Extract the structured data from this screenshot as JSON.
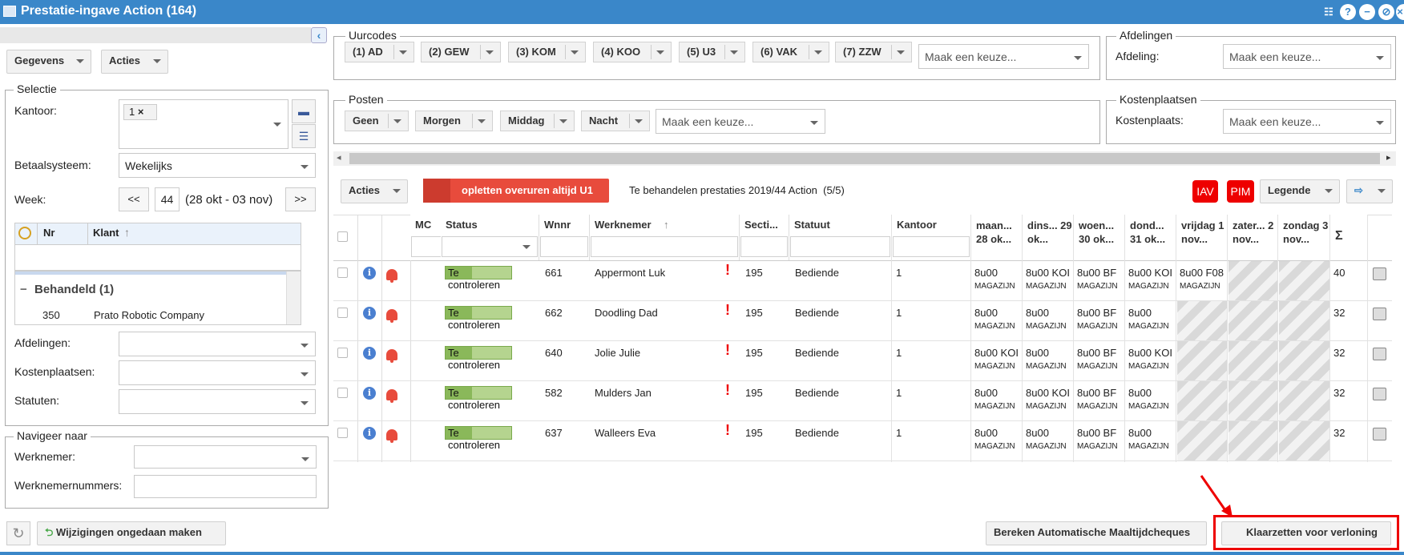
{
  "window": {
    "title": "Prestatie-ingave Action (164)"
  },
  "left": {
    "gegevens": "Gegevens",
    "acties": "Acties",
    "selectie": "Selectie",
    "kantoor_label": "Kantoor:",
    "kantoor_chip": "1",
    "betaal_label": "Betaalsysteem:",
    "betaal_value": "Wekelijks",
    "week_label": "Week:",
    "prev": "<<",
    "week_num": "44",
    "week_range": "(28 okt - 03 nov)",
    "next": ">>",
    "klant_cols": [
      "Nr",
      "Klant"
    ],
    "group": "Behandeld (1)",
    "klant_row": {
      "nr": "350",
      "naam": "Prato Robotic Company"
    },
    "afd_label": "Afdelingen:",
    "kost_label": "Kostenplaatsen:",
    "stat_label": "Statuten:",
    "navigeer": "Navigeer naar",
    "werknemer_label": "Werknemer:",
    "wnrs_label": "Werknemernummers:"
  },
  "uurcodes": {
    "legend": "Uurcodes",
    "chips": [
      "(1) AD",
      "(2) GEW",
      "(3) KOM",
      "(4) KOO",
      "(5) U3",
      "(6) VAK",
      "(7) ZZW"
    ],
    "placeholder": "Maak een keuze..."
  },
  "afdelingen": {
    "legend": "Afdelingen",
    "label": "Afdeling:",
    "placeholder": "Maak een keuze..."
  },
  "posten": {
    "legend": "Posten",
    "chips": [
      "Geen",
      "Morgen",
      "Middag",
      "Nacht"
    ],
    "placeholder": "Maak een keuze..."
  },
  "kostenplaatsen": {
    "legend": "Kostenplaatsen",
    "label": "Kostenplaats:",
    "placeholder": "Maak een keuze..."
  },
  "toolbar": {
    "acties": "Acties",
    "alert": "opletten overuren altijd U1",
    "info": "Te behandelen prestaties 2019/44 Action  (5/5)",
    "iav": "IAV",
    "pim": "PIM",
    "legende": "Legende"
  },
  "grid": {
    "headers": [
      "MC",
      "Status",
      "Wnnr",
      "Werknemer",
      "Secti...",
      "Statuut",
      "Kantoor",
      "maan... 28 ok...",
      "dins... 29 ok...",
      "woen... 30 ok...",
      "dond... 31 ok...",
      "vrijdag 1 nov...",
      "zater... 2 nov...",
      "zondag 3 nov...",
      "Σ"
    ],
    "rows": [
      {
        "status": "Te controleren",
        "wnnr": "661",
        "naam": "Appermont Luk",
        "sectie": "195",
        "statuut": "Bediende",
        "kantoor": "1",
        "days": [
          [
            "8u00",
            "MAGAZIJN"
          ],
          [
            "8u00 KOI",
            "MAGAZIJN"
          ],
          [
            "8u00 BF",
            "MAGAZIJN"
          ],
          [
            "8u00 KOI",
            "MAGAZIJN"
          ],
          [
            "8u00 F08",
            "MAGAZIJN"
          ]
        ],
        "sum": "40"
      },
      {
        "status": "Te controleren",
        "wnnr": "662",
        "naam": "Doodling Dad",
        "sectie": "195",
        "statuut": "Bediende",
        "kantoor": "1",
        "days": [
          [
            "8u00",
            "MAGAZIJN"
          ],
          [
            "8u00",
            "MAGAZIJN"
          ],
          [
            "8u00 BF",
            "MAGAZIJN"
          ],
          [
            "8u00",
            "MAGAZIJN"
          ]
        ],
        "sum": "32"
      },
      {
        "status": "Te controleren",
        "wnnr": "640",
        "naam": "Jolie Julie",
        "sectie": "195",
        "statuut": "Bediende",
        "kantoor": "1",
        "days": [
          [
            "8u00 KOI",
            "MAGAZIJN"
          ],
          [
            "8u00",
            "MAGAZIJN"
          ],
          [
            "8u00 BF",
            "MAGAZIJN"
          ],
          [
            "8u00 KOI",
            "MAGAZIJN"
          ]
        ],
        "sum": "32"
      },
      {
        "status": "Te controleren",
        "wnnr": "582",
        "naam": "Mulders Jan",
        "sectie": "195",
        "statuut": "Bediende",
        "kantoor": "1",
        "days": [
          [
            "8u00",
            "MAGAZIJN"
          ],
          [
            "8u00 KOI",
            "MAGAZIJN"
          ],
          [
            "8u00 BF",
            "MAGAZIJN"
          ],
          [
            "8u00",
            "MAGAZIJN"
          ]
        ],
        "sum": "32"
      },
      {
        "status": "Te controleren",
        "wnnr": "637",
        "naam": "Walleers Eva",
        "sectie": "195",
        "statuut": "Bediende",
        "kantoor": "1",
        "days": [
          [
            "8u00",
            "MAGAZIJN"
          ],
          [
            "8u00",
            "MAGAZIJN"
          ],
          [
            "8u00 BF",
            "MAGAZIJN"
          ],
          [
            "8u00",
            "MAGAZIJN"
          ]
        ],
        "sum": "32"
      }
    ]
  },
  "footer": {
    "undo": "Wijzigingen ongedaan maken",
    "bereken": "Bereken Automatische Maaltijdcheques",
    "klaar": "Klaarzetten voor verloning"
  },
  "colors": {
    "title_bar": "#3a87c9",
    "status_green": "#8ab85a",
    "alert_red": "#e84b3c",
    "badge_red": "#e00000",
    "highlight": "#e00000"
  }
}
